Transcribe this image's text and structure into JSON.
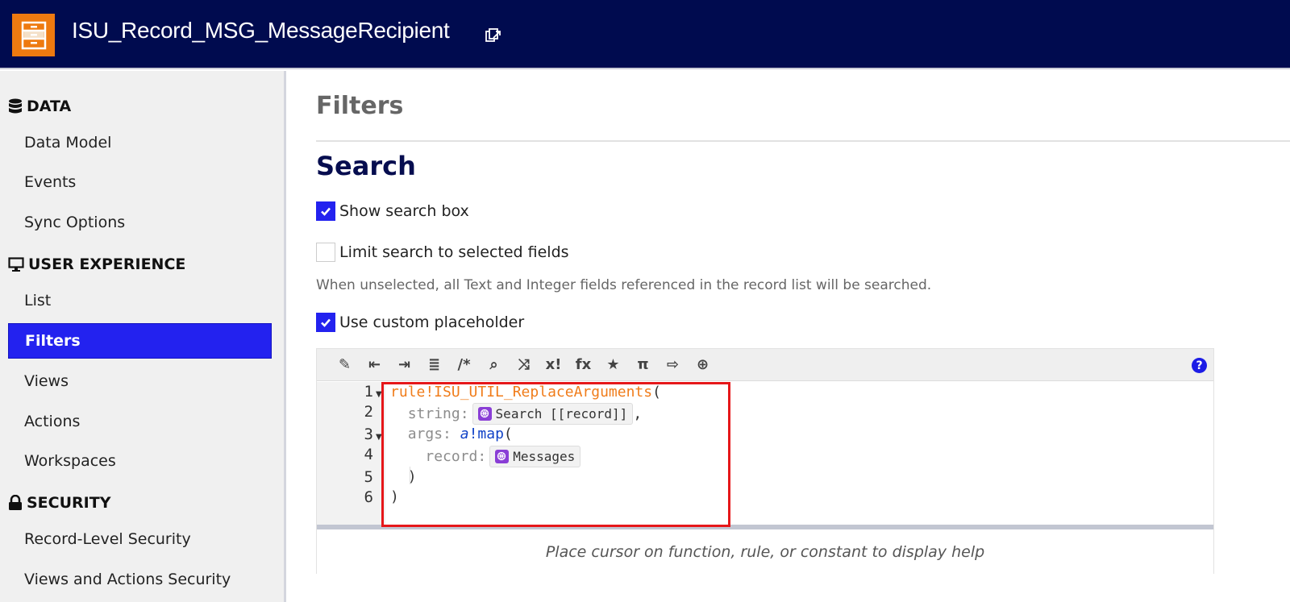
{
  "header": {
    "title": "ISU_Record_MSG_MessageRecipient",
    "logo_icon": "record-type-cabinet-icon",
    "link_icon": "open-in-new-icon"
  },
  "sidebar": {
    "sections": [
      {
        "label": "DATA",
        "icon": "database-icon",
        "items": [
          {
            "label": "Data Model"
          },
          {
            "label": "Events"
          },
          {
            "label": "Sync Options"
          }
        ]
      },
      {
        "label": "USER EXPERIENCE",
        "icon": "monitor-icon",
        "items": [
          {
            "label": "List"
          },
          {
            "label": "Filters",
            "active": true
          },
          {
            "label": "Views"
          },
          {
            "label": "Actions"
          },
          {
            "label": "Workspaces"
          }
        ]
      },
      {
        "label": "SECURITY",
        "icon": "lock-icon",
        "items": [
          {
            "label": "Record-Level Security"
          },
          {
            "label": "Views and Actions Security"
          }
        ]
      }
    ]
  },
  "main": {
    "page_title": "Filters",
    "section_title": "Search",
    "checkboxes": [
      {
        "label": "Show search box",
        "checked": true
      },
      {
        "label": "Limit search to selected fields",
        "checked": false
      },
      {
        "label": "Use custom placeholder",
        "checked": true
      }
    ],
    "helper_text": "When unselected, all Text and Integer fields referenced in the record list will be searched.",
    "editor": {
      "toolbar": [
        {
          "icon": "magic-wand-icon",
          "glyph": "✎"
        },
        {
          "icon": "outdent-icon",
          "glyph": "⇤"
        },
        {
          "icon": "indent-icon",
          "glyph": "⇥"
        },
        {
          "icon": "format-lines-icon",
          "glyph": "≣"
        },
        {
          "icon": "comment-icon",
          "glyph": "/*"
        },
        {
          "icon": "search-icon",
          "glyph": "⌕"
        },
        {
          "icon": "shuffle-icon",
          "glyph": "⤨"
        },
        {
          "icon": "variable-icon",
          "glyph": "x!"
        },
        {
          "icon": "function-icon",
          "glyph": "fx"
        },
        {
          "icon": "star-icon",
          "glyph": "★"
        },
        {
          "icon": "pi-constant-icon",
          "glyph": "π"
        },
        {
          "icon": "export-icon",
          "glyph": "⇨"
        },
        {
          "icon": "globe-translation-icon",
          "glyph": "⊕"
        }
      ],
      "help_label": "?",
      "line_numbers": [
        "1",
        "2",
        "3",
        "4",
        "5",
        "6"
      ],
      "code": {
        "l1_rule": "rule!ISU_UTIL_ReplaceArguments",
        "l1_paren": "(",
        "l2_key": "string:",
        "l2_chip": "Search [[record]]",
        "l2_comma": ",",
        "l3_key": "args:",
        "l3_fn_prefix": "a",
        "l3_fn": "!map",
        "l3_paren": "(",
        "l4_key": "record:",
        "l4_chip": "Messages",
        "l5": ")",
        "l6": ")"
      },
      "help_text": "Place cursor on function, rule, or constant to display help"
    }
  },
  "colors": {
    "header_bg": "#000b4f",
    "accent": "#2322ef",
    "logo": "#ee7a10",
    "highlight_box": "#e6171a"
  }
}
